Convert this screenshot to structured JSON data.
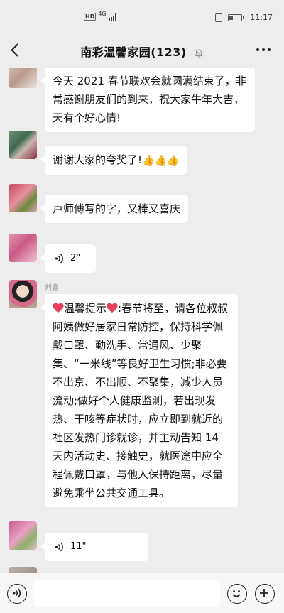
{
  "status_bar": {
    "network_badge": "HD",
    "network_type": "4G",
    "time": "11:17"
  },
  "header": {
    "back_icon": "chevron-left-icon",
    "title": "南彩温馨家园(123)",
    "mute_icon": "bell-muted-icon",
    "more_icon": "more-dots-icon"
  },
  "messages": [
    {
      "type": "text",
      "sender": "",
      "text": "今天 2021 春节联欢会就圆满结束了，非常感谢朋友们的到来，祝大家牛年大吉，天有个好心情!"
    },
    {
      "type": "text",
      "sender": "",
      "text": "谢谢大家的夸奖了!",
      "emoji": "👍👍👍"
    },
    {
      "type": "text",
      "sender": "",
      "text": "卢师傅写的字，又棒又喜庆"
    },
    {
      "type": "voice",
      "sender": "",
      "duration": "2\""
    },
    {
      "type": "text",
      "sender": "刘鑫",
      "heart_icon": "heart-icon",
      "text_a": "温馨提示",
      "text_b": ":春节将至，请各位叔叔阿姨做好居家日常防控，保持科学佩戴口罩、勤洗手、常通风、少聚集、“一米线”等良好卫生习惯;非必要不出京、不出顺、不聚集，减少人员流动;做好个人健康监测，若出现发热、干咳等症状时，应立即到就近的社区发热门诊就诊，并主动告知 14 天内活动史、接触史，就医途中应全程佩戴口罩，与他人保持距离，尽量避免乘坐公共交通工具。"
    },
    {
      "type": "voice",
      "sender": "",
      "duration": "11\""
    }
  ],
  "input_bar": {
    "voice_toggle_icon": "voice-input-icon",
    "emoji_icon": "emoji-smile-icon",
    "plus_icon": "plus-icon",
    "input_value": ""
  },
  "colors": {
    "background": "#ededed",
    "bubble": "#ffffff",
    "heart": "#e8405a"
  }
}
